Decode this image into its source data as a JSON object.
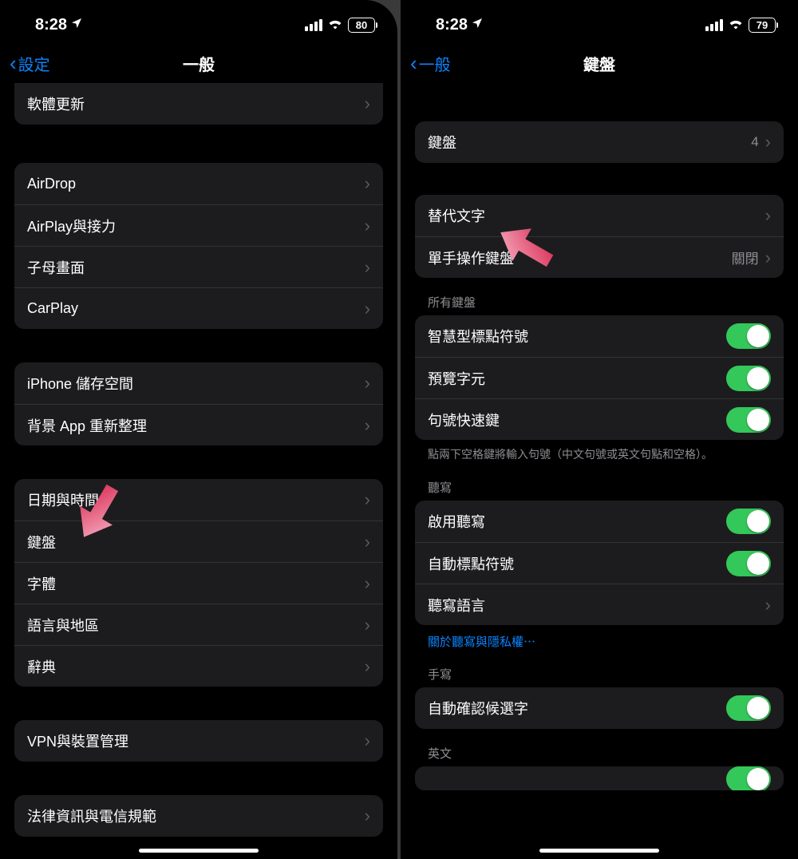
{
  "left": {
    "status": {
      "time": "8:28",
      "battery": "80"
    },
    "nav": {
      "back": "設定",
      "title": "一般"
    },
    "groupTop": {
      "item0": "軟體更新"
    },
    "group1": {
      "airdrop": "AirDrop",
      "airplay": "AirPlay與接力",
      "pip": "子母畫面",
      "carplay": "CarPlay"
    },
    "group2": {
      "storage": "iPhone 儲存空間",
      "bgrefresh": "背景 App 重新整理"
    },
    "group3": {
      "datetime": "日期與時間",
      "keyboard": "鍵盤",
      "font": "字體",
      "lang": "語言與地區",
      "dict": "辭典"
    },
    "group4": {
      "vpn": "VPN與裝置管理"
    },
    "group5": {
      "legal": "法律資訊與電信規範"
    }
  },
  "right": {
    "status": {
      "time": "8:28",
      "battery": "79"
    },
    "nav": {
      "back": "一般",
      "title": "鍵盤"
    },
    "group1": {
      "keyboards": "鍵盤",
      "keyboardsCount": "4"
    },
    "group2": {
      "textreplace": "替代文字",
      "onehand": "單手操作鍵盤",
      "onehandVal": "關閉"
    },
    "headerAll": "所有鍵盤",
    "group3": {
      "smartpunct": "智慧型標點符號",
      "preview": "預覽字元",
      "period": "句號快速鍵"
    },
    "footerPeriod": "點兩下空格鍵將輸入句號（中文句號或英文句點和空格）。",
    "headerDictation": "聽寫",
    "group4": {
      "enable": "啟用聽寫",
      "autopunct": "自動標點符號",
      "lang": "聽寫語言"
    },
    "linkPrivacy": "關於聽寫與隱私權⋯",
    "headerHandwrite": "手寫",
    "group5": {
      "autoconfirm": "自動確認候選字"
    },
    "headerEnglish": "英文"
  }
}
